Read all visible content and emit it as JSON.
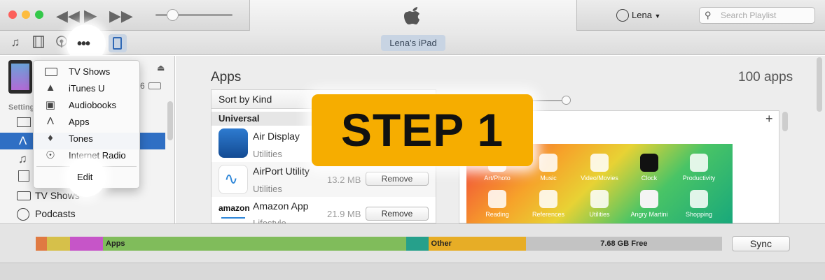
{
  "titlebar": {
    "user": "Lena",
    "search_placeholder": "Search Playlist",
    "traffic_colors": [
      "#fc605c",
      "#fdbc40",
      "#34c84a"
    ]
  },
  "toolbar": {
    "icons": [
      "music-icon",
      "movies-icon",
      "podcasts-icon",
      "more-icon",
      "ipad-icon"
    ],
    "device_label": "Lena's iPad"
  },
  "menu": {
    "items": [
      {
        "label": "TV Shows",
        "icon": "tv-icon"
      },
      {
        "label": "iTunes U",
        "icon": "mortarboard-icon"
      },
      {
        "label": "Audiobooks",
        "icon": "book-icon"
      },
      {
        "label": "Apps",
        "icon": "apps-icon"
      },
      {
        "label": "Tones",
        "icon": "bell-icon"
      },
      {
        "label": "Internet Radio",
        "icon": "radio-icon"
      }
    ],
    "edit_label": "Edit"
  },
  "sidebar": {
    "settings_label": "Setting",
    "capacity_fragment": "6",
    "items": [
      {
        "label": "TV Shows",
        "icon": "tv-icon"
      },
      {
        "label": "Podcasts",
        "icon": "podcasts-icon"
      }
    ]
  },
  "apps": {
    "title": "Apps",
    "count": "100 apps",
    "sort_label": "Sort by Kind",
    "section": "Universal",
    "list": [
      {
        "name": "Air Display",
        "category": "Utilities",
        "size": "",
        "button": ""
      },
      {
        "name": "AirPort Utility",
        "category": "Utilities",
        "size": "13.2 MB",
        "button": "Remove"
      },
      {
        "name": "Amazon App",
        "category": "Lifestyle",
        "size": "21.9 MB",
        "button": "Remove"
      }
    ],
    "amazon_logo": "amazon"
  },
  "homescreen": {
    "labels": [
      "Art/Photo",
      "Music",
      "Video/Movies",
      "Clock",
      "Productivity",
      "Reading",
      "References",
      "Utilities",
      "Angry Martini",
      "Shopping"
    ],
    "add_symbol": "+"
  },
  "storage": {
    "apps_label": "Apps",
    "other_label": "Other",
    "free_label": "7.68 GB Free",
    "sync_label": "Sync",
    "colors": {
      "orange": "#e07a42",
      "yellow": "#d6c04a",
      "magenta": "#c655c8",
      "apps": "#80bc5b",
      "teal": "#26a08b",
      "other": "#e7ad26",
      "free": "#c3c3c3"
    },
    "fractions": {
      "orange": 0.016,
      "yellow": 0.034,
      "magenta": 0.048,
      "apps": 0.442,
      "teal": 0.032,
      "other": 0.142,
      "free": 0.286
    }
  },
  "overlay": {
    "text": "STEP 1"
  }
}
